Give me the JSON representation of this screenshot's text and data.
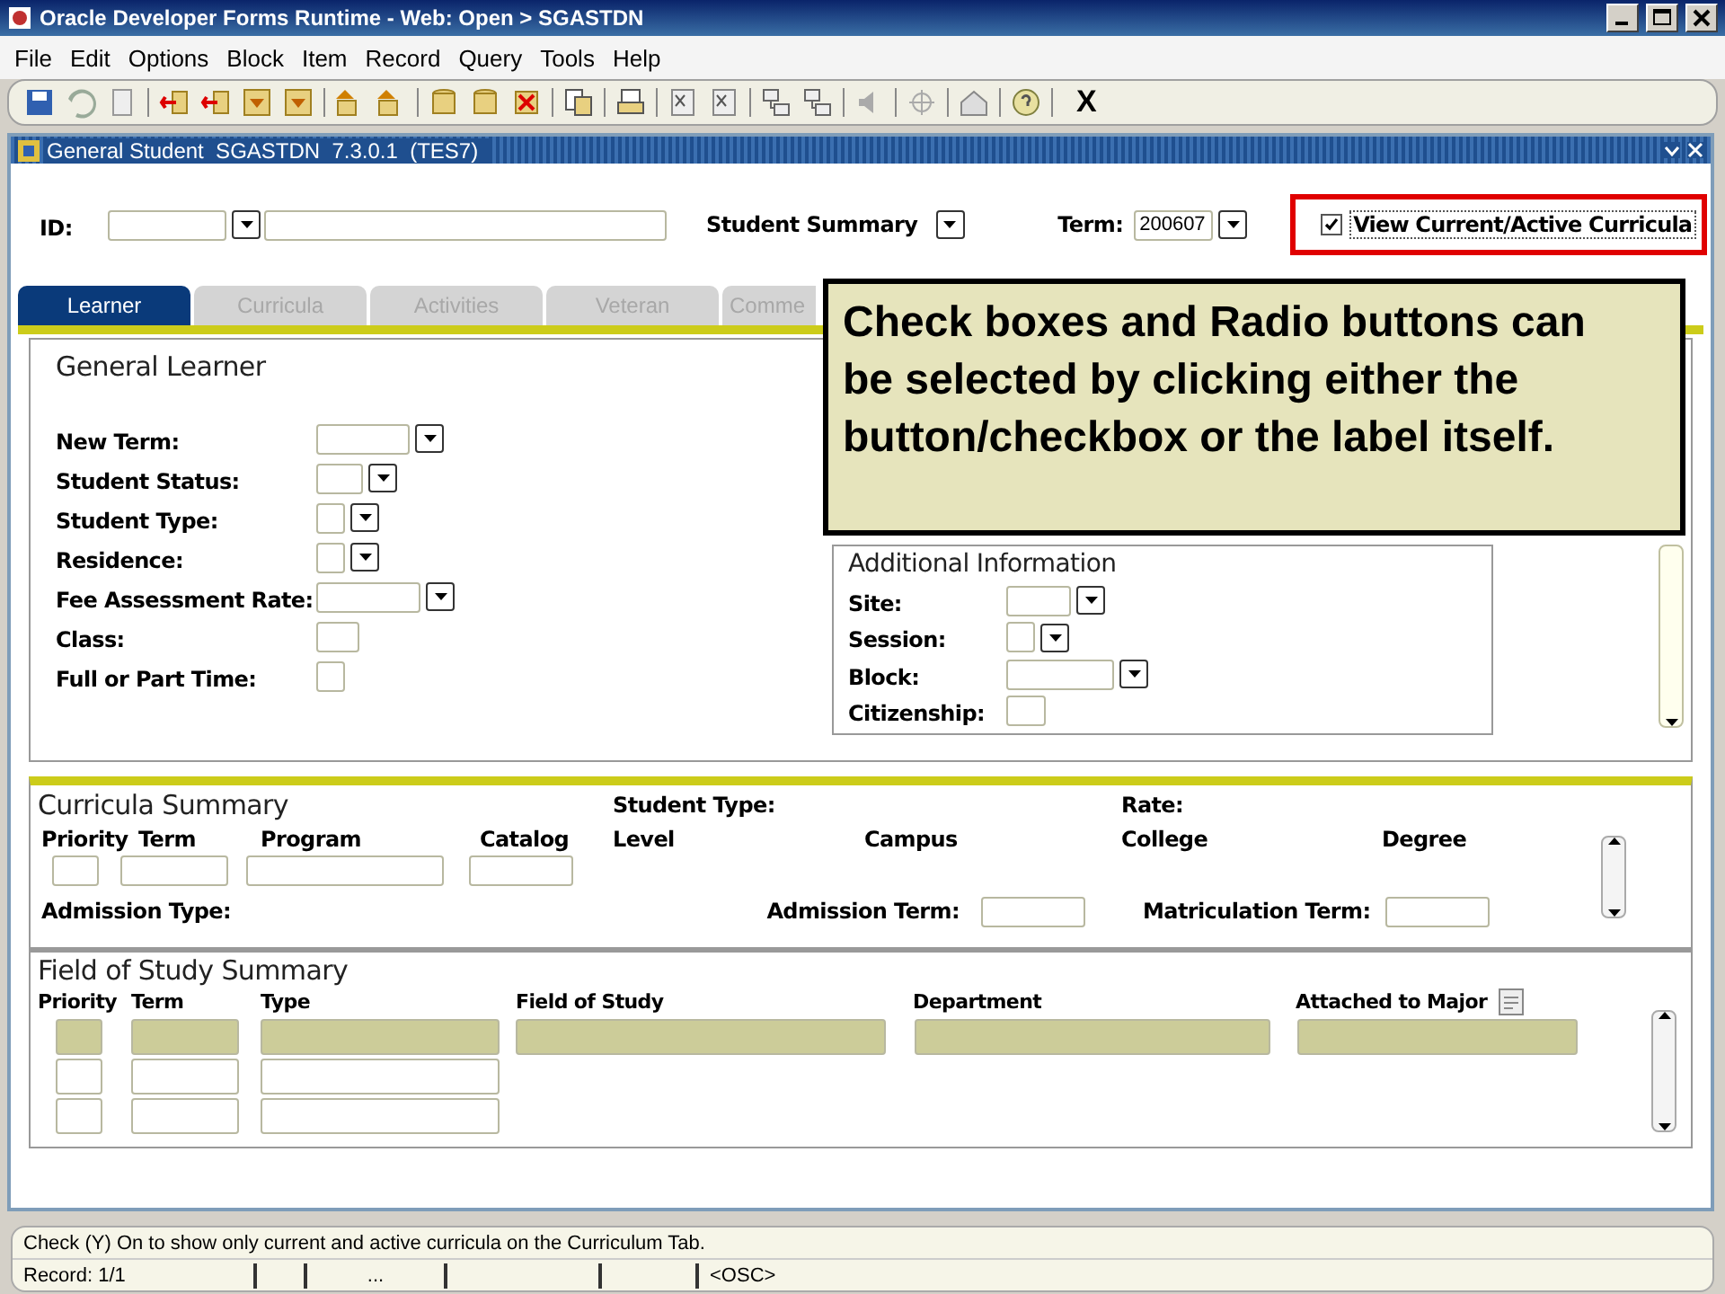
{
  "window": {
    "title": "Oracle Developer Forms Runtime - Web:  Open > SGASTDN"
  },
  "menu": [
    "File",
    "Edit",
    "Options",
    "Block",
    "Item",
    "Record",
    "Query",
    "Tools",
    "Help"
  ],
  "toolbar": {
    "exit_label": "X"
  },
  "form": {
    "title": "General Student  SGASTDN  7.3.0.1  (TES7)"
  },
  "header": {
    "id_label": "ID:",
    "summary_label": "Student Summary",
    "term_label": "Term:",
    "term_value": "200607",
    "curricula_checkbox": {
      "label": "View Current/Active Curricula",
      "checked": true
    }
  },
  "tabs": [
    {
      "label": "Learner",
      "selected": true
    },
    {
      "label": "Curricula",
      "selected": false
    },
    {
      "label": "Activities",
      "selected": false
    },
    {
      "label": "Veteran",
      "selected": false
    },
    {
      "label": "Comme",
      "selected": false
    }
  ],
  "general_learner": {
    "title": "General Learner",
    "fields": [
      {
        "label": "New Term:",
        "kind": "list"
      },
      {
        "label": "Student Status:",
        "kind": "list"
      },
      {
        "label": "Student Type:",
        "kind": "list"
      },
      {
        "label": "Residence:",
        "kind": "list"
      },
      {
        "label": "Fee Assessment Rate:",
        "kind": "list"
      },
      {
        "label": "Class:",
        "kind": "text"
      },
      {
        "label": "Full or Part Time:",
        "kind": "text"
      }
    ]
  },
  "additional_information": {
    "title": "Additional Information",
    "fields": [
      {
        "label": "Site:",
        "kind": "list"
      },
      {
        "label": "Session:",
        "kind": "list"
      },
      {
        "label": "Block:",
        "kind": "list"
      },
      {
        "label": "Citizenship:",
        "kind": "text"
      }
    ]
  },
  "curricula_summary": {
    "title": "Curricula Summary",
    "columns": [
      "Priority",
      "Term",
      "Program",
      "Catalog"
    ],
    "student_type_label": "Student Type:",
    "rate_label": "Rate:",
    "detail_columns": [
      "Level",
      "Campus",
      "College",
      "Degree"
    ],
    "admission_type_label": "Admission Type:",
    "admission_term_label": "Admission Term:",
    "matriculation_term_label": "Matriculation Term:"
  },
  "field_of_study": {
    "title": "Field of Study Summary",
    "columns": [
      "Priority",
      "Term",
      "Type",
      "Field of Study",
      "Department",
      "Attached to Major"
    ],
    "rows": [
      {
        "current": true
      },
      {
        "current": false
      },
      {
        "current": false
      }
    ]
  },
  "status_bar": {
    "message": "Check (Y) On to show only current and active curricula on the Curriculum Tab.",
    "record": "Record: 1/1",
    "ellipsis": "...",
    "mode": "<OSC>"
  },
  "callout": {
    "text": "Check boxes and Radio buttons can be selected by clicking either the button/checkbox or the label itself."
  }
}
